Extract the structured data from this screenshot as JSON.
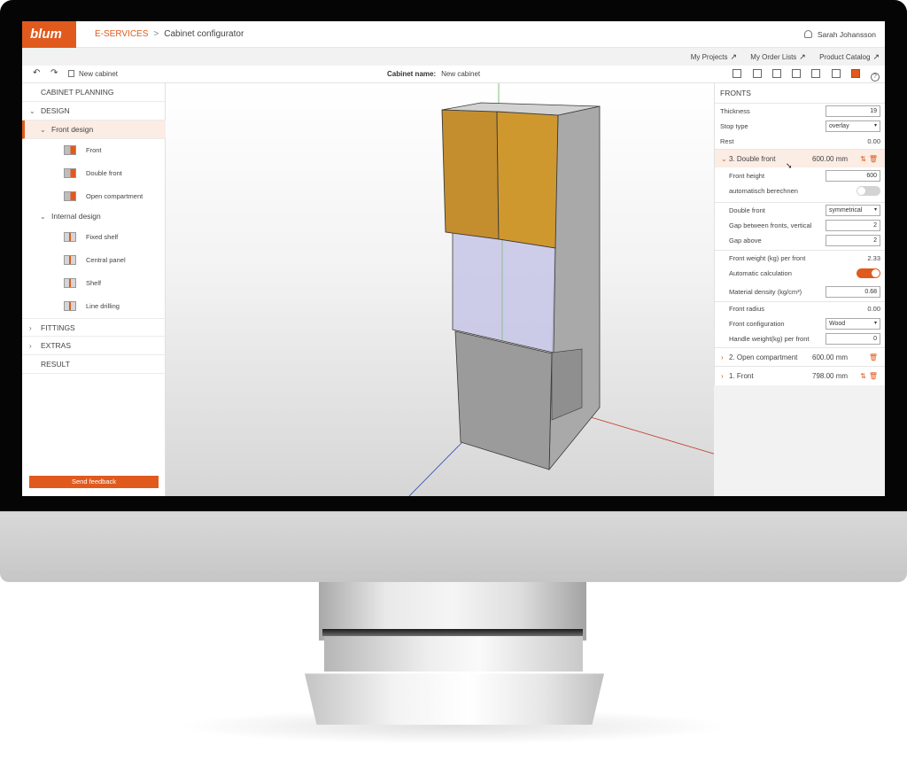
{
  "app": {
    "logo": "blum",
    "breadcrumb_1": "E-SERVICES",
    "breadcrumb_sep": ">",
    "breadcrumb_2": "Cabinet configurator",
    "user": "Sarah Johansson",
    "accent": "#e05a1e"
  },
  "links": {
    "my_projects": "My Projects",
    "my_order_lists": "My Order Lists",
    "product_catalog": "Product Catalog",
    "arrow": "↗"
  },
  "toolbar": {
    "undo": "↶",
    "redo": "↷",
    "new_cabinet": "New cabinet",
    "cabinet_name_label": "Cabinet name:",
    "cabinet_name_value": "New cabinet",
    "help": "?"
  },
  "sidebar": {
    "cabinet_planning": "CABINET PLANNING",
    "design": "DESIGN",
    "front_design": "Front design",
    "front_items": [
      "Front",
      "Double front",
      "Open compartment"
    ],
    "internal_design": "Internal design",
    "internal_items": [
      "Fixed shelf",
      "Central panel",
      "Shelf",
      "Line drilling"
    ],
    "fittings": "FITTINGS",
    "extras": "EXTRAS",
    "result": "RESULT",
    "feedback": "Send feedback",
    "chev_open": "⌄",
    "chev_closed": "›"
  },
  "fronts": {
    "title": "FRONTS",
    "thickness_label": "Thickness",
    "thickness_value": "19",
    "stop_type_label": "Stop type",
    "stop_type_value": "overlay",
    "rest_label": "Rest",
    "rest_value": "0.00",
    "section3_label": "3. Double front",
    "section3_mm": "600.00 mm",
    "front_height_label": "Front height",
    "front_height_value": "600",
    "auto_calc_de_label": "automatisch berechnen",
    "auto_calc_de_on": false,
    "double_front_label": "Double front",
    "double_front_value": "symmetrical",
    "gap_vertical_label": "Gap between fronts, vertical",
    "gap_vertical_value": "2",
    "gap_above_label": "Gap above",
    "gap_above_value": "2",
    "front_weight_label": "Front weight (kg)  per front",
    "front_weight_value": "2.33",
    "auto_calc_label": "Automatic calculation",
    "auto_calc_on": true,
    "material_density_label": "Material density (kg/cm³)",
    "material_density_value": "0.68",
    "front_radius_label": "Front radius",
    "front_radius_value": "0.00",
    "front_config_label": "Front configuration",
    "front_config_value": "Wood",
    "handle_weight_label": "Handle weight(kg) per front",
    "handle_weight_value": "0",
    "section2_label": "2. Open compartment",
    "section2_mm": "600.00 mm",
    "section1_label": "1. Front",
    "section1_mm": "798.00 mm",
    "dd": "▾"
  }
}
